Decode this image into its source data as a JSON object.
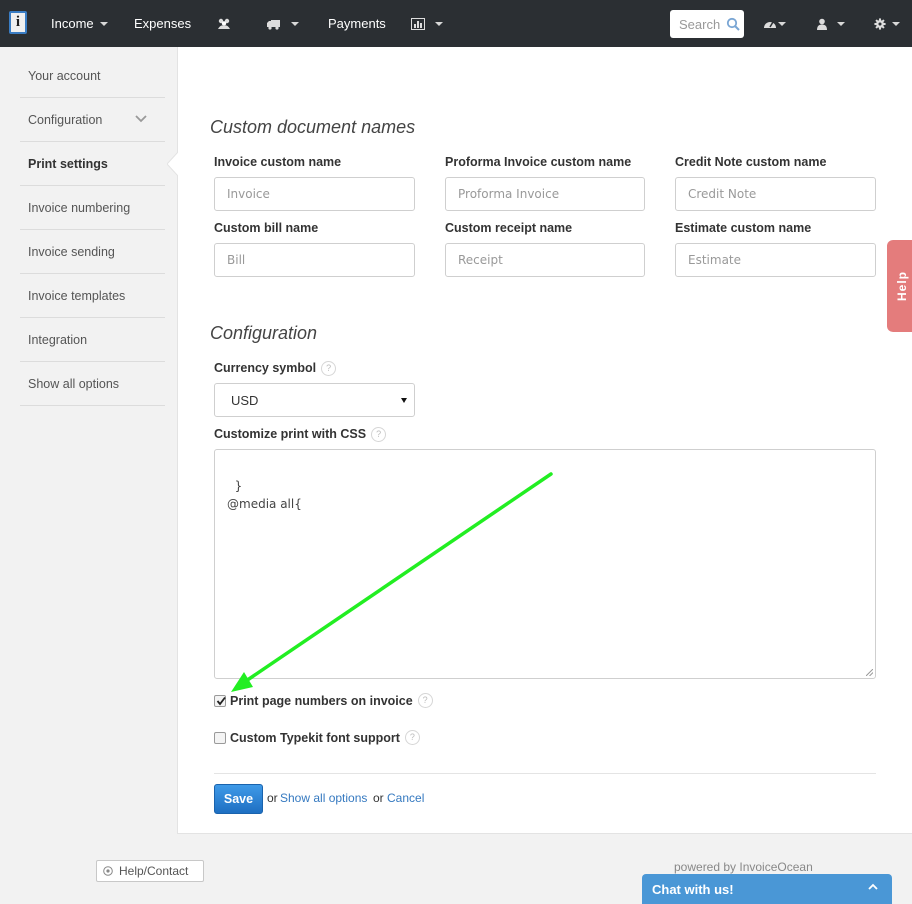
{
  "navbar": {
    "logo_letter": "i",
    "menu": [
      {
        "label": "Income",
        "has_caret": true
      },
      {
        "label": "Expenses",
        "has_caret": false
      },
      {
        "icon": "clients-icon",
        "has_caret": false
      },
      {
        "icon": "truck-icon",
        "has_caret": true
      },
      {
        "label": "Payments",
        "has_caret": false
      },
      {
        "icon": "reports-chart-icon",
        "has_caret": true
      }
    ],
    "search": {
      "placeholder": "Search",
      "value": ""
    },
    "right_icons": [
      "dashboard-icon",
      "user-icon",
      "settings-gear-icon"
    ]
  },
  "sidebar": {
    "items": [
      {
        "label": "Your account"
      },
      {
        "label": "Configuration"
      },
      {
        "label": "Print settings",
        "active": true
      },
      {
        "label": "Invoice numbering"
      },
      {
        "label": "Invoice sending"
      },
      {
        "label": "Invoice templates"
      },
      {
        "label": "Integration"
      },
      {
        "label": "Show all options"
      }
    ]
  },
  "custom_names": {
    "title": "Custom document names",
    "fields": [
      {
        "label": "Invoice custom name",
        "placeholder": "Invoice"
      },
      {
        "label": "Proforma Invoice custom name",
        "placeholder": "Proforma Invoice"
      },
      {
        "label": "Credit Note custom name",
        "placeholder": "Credit Note"
      },
      {
        "label": "Custom bill name",
        "placeholder": "Bill"
      },
      {
        "label": "Custom receipt name",
        "placeholder": "Receipt"
      },
      {
        "label": "Estimate custom name",
        "placeholder": "Estimate"
      }
    ]
  },
  "configuration": {
    "title": "Configuration",
    "currency_label": "Currency symbol",
    "currency_value": "USD",
    "css_label": "Customize print with CSS",
    "css_value": "}\n@media all{",
    "page_numbers_label": "Print page numbers on invoice",
    "page_numbers_checked": true,
    "typekit_label": "Custom Typekit font support",
    "typekit_checked": false,
    "help_glyph": "?"
  },
  "actions": {
    "save_label": "Save",
    "or1": "or",
    "show_all_label": "Show all options",
    "or2": "or",
    "cancel_label": "Cancel"
  },
  "help_tab": {
    "label": "Help"
  },
  "footer": {
    "help_contact_label": "Help/Contact",
    "powered_by": "powered by InvoiceOcean",
    "chat_label": "Chat with us!"
  },
  "colors": {
    "navbar_bg": "#2b2f33",
    "primary_button": "#2a82d6",
    "link": "#3579c0",
    "help_tab": "#e47c7c",
    "chat_bar": "#4a97d6",
    "annotation_arrow": "#22ee22"
  }
}
